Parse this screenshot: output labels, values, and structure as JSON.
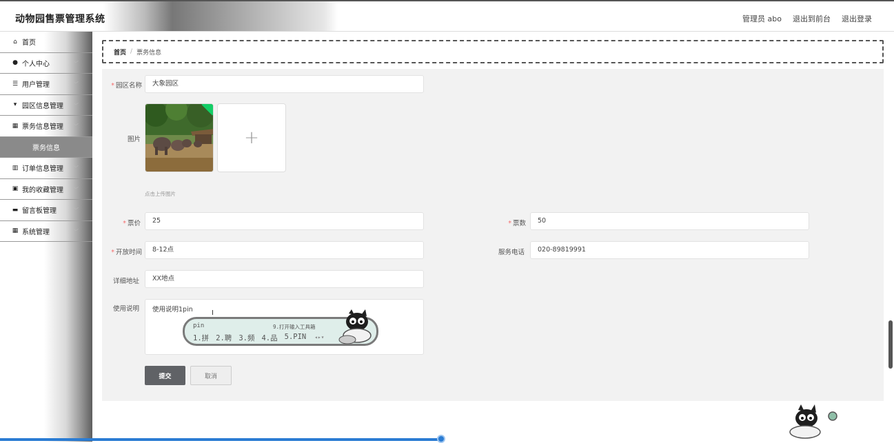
{
  "app": {
    "title": "动物园售票管理系统",
    "user_label": "管理员 abo",
    "back_to_front": "退出到前台",
    "logout": "退出登录"
  },
  "sidebar": {
    "items": [
      {
        "label": "首页",
        "icon": "home-icon",
        "glyph": "⌂",
        "has_children": false
      },
      {
        "label": "个人中心",
        "icon": "user-icon",
        "glyph": "●",
        "has_children": true
      },
      {
        "label": "用户管理",
        "icon": "menu-icon",
        "glyph": "☰",
        "has_children": true
      },
      {
        "label": "园区信息管理",
        "icon": "flag-icon",
        "glyph": "▾",
        "has_children": true
      },
      {
        "label": "票务信息管理",
        "icon": "grid-icon",
        "glyph": "▦",
        "has_children": true
      },
      {
        "label": "票务信息",
        "icon": "",
        "glyph": "",
        "has_children": false,
        "submenu": true
      },
      {
        "label": "订单信息管理",
        "icon": "bar-chart-icon",
        "glyph": "▥",
        "has_children": true
      },
      {
        "label": "我的收藏管理",
        "icon": "clipboard-icon",
        "glyph": "▣",
        "has_children": true
      },
      {
        "label": "留言板管理",
        "icon": "monitor-icon",
        "glyph": "▬",
        "has_children": true
      },
      {
        "label": "系统管理",
        "icon": "grid-icon",
        "glyph": "▦",
        "has_children": true
      }
    ]
  },
  "breadcrumb": {
    "home": "首页",
    "separator": "/",
    "current": "票务信息"
  },
  "form": {
    "park_name_label": "园区名称",
    "park_name_value": "大象园区",
    "image_label": "图片",
    "upload_tip": "点击上传图片",
    "price_label": "票价",
    "price_value": "25",
    "count_label": "票数",
    "count_value": "50",
    "hours_label": "开放时间",
    "hours_value": "8-12点",
    "phone_label": "服务电话",
    "phone_value": "020-89819991",
    "address_label": "详细地址",
    "address_value": "XX地点",
    "usage_label": "使用说明",
    "usage_value": "使用说明1pin",
    "submit": "提交",
    "cancel": "取消"
  },
  "ime": {
    "input": "pin",
    "tip": "9.打开输入工具箱",
    "candidates": [
      "1.拼",
      "2.聘",
      "3.频",
      "4.品",
      "5.PIN"
    ]
  },
  "colors": {
    "required": "#f56c6c",
    "submit_bg": "#606266",
    "accent_blue": "#2b7cd3"
  }
}
